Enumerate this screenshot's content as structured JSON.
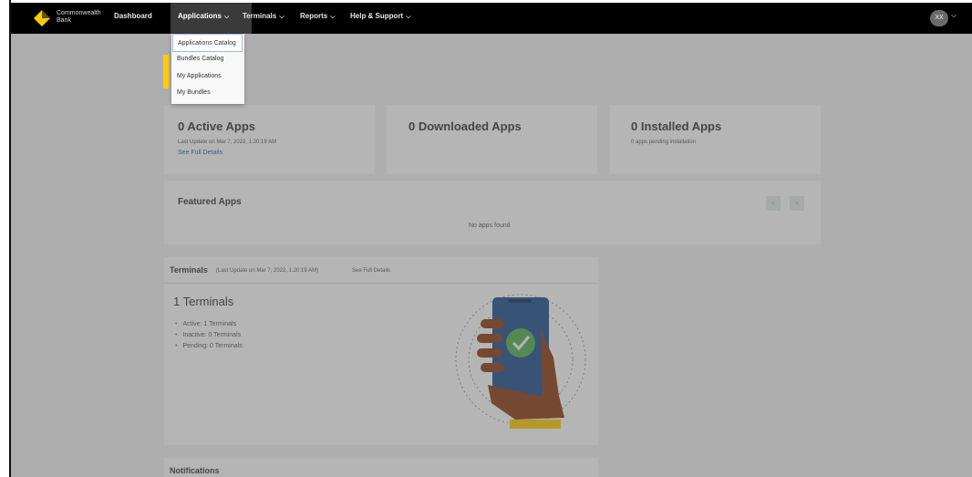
{
  "brand": {
    "name_line1": "Commonwealth",
    "name_line2": "Bank"
  },
  "nav": {
    "dashboard": "Dashboard",
    "applications": "Applications",
    "terminals": "Terminals",
    "reports": "Reports",
    "help": "Help & Support",
    "user_initials": "XX"
  },
  "dropdown": {
    "items": [
      "Applications Catalog",
      "Bundles Catalog",
      "My Applications",
      "My Bundles"
    ]
  },
  "stats": {
    "active": {
      "title": "0 Active Apps",
      "updated": "Last Update on Mar 7, 2022, 1:20:19 AM",
      "link": "See Full Details"
    },
    "downloaded": {
      "title": "0 Downloaded Apps"
    },
    "installed": {
      "title": "0 Installed Apps",
      "pending_count": "0",
      "pending_text": "apps pending installation"
    }
  },
  "featured": {
    "title": "Featured Apps",
    "empty": "No apps found"
  },
  "terminals": {
    "header": "Terminals",
    "updated": "(Last Update on Mar 7, 2022, 1:20:19 AM)",
    "link": "See Full Details",
    "count_title": "1 Terminals",
    "items": [
      "Active: 1 Terminals",
      "Inactive: 0 Terminals",
      "Pending: 0 Terminals"
    ]
  },
  "notifications": {
    "title": "Notifications"
  },
  "colors": {
    "accent": "#ffcc00",
    "link": "#1a5fb4",
    "nav_bg": "#000000",
    "success": "#2e8b2e"
  }
}
